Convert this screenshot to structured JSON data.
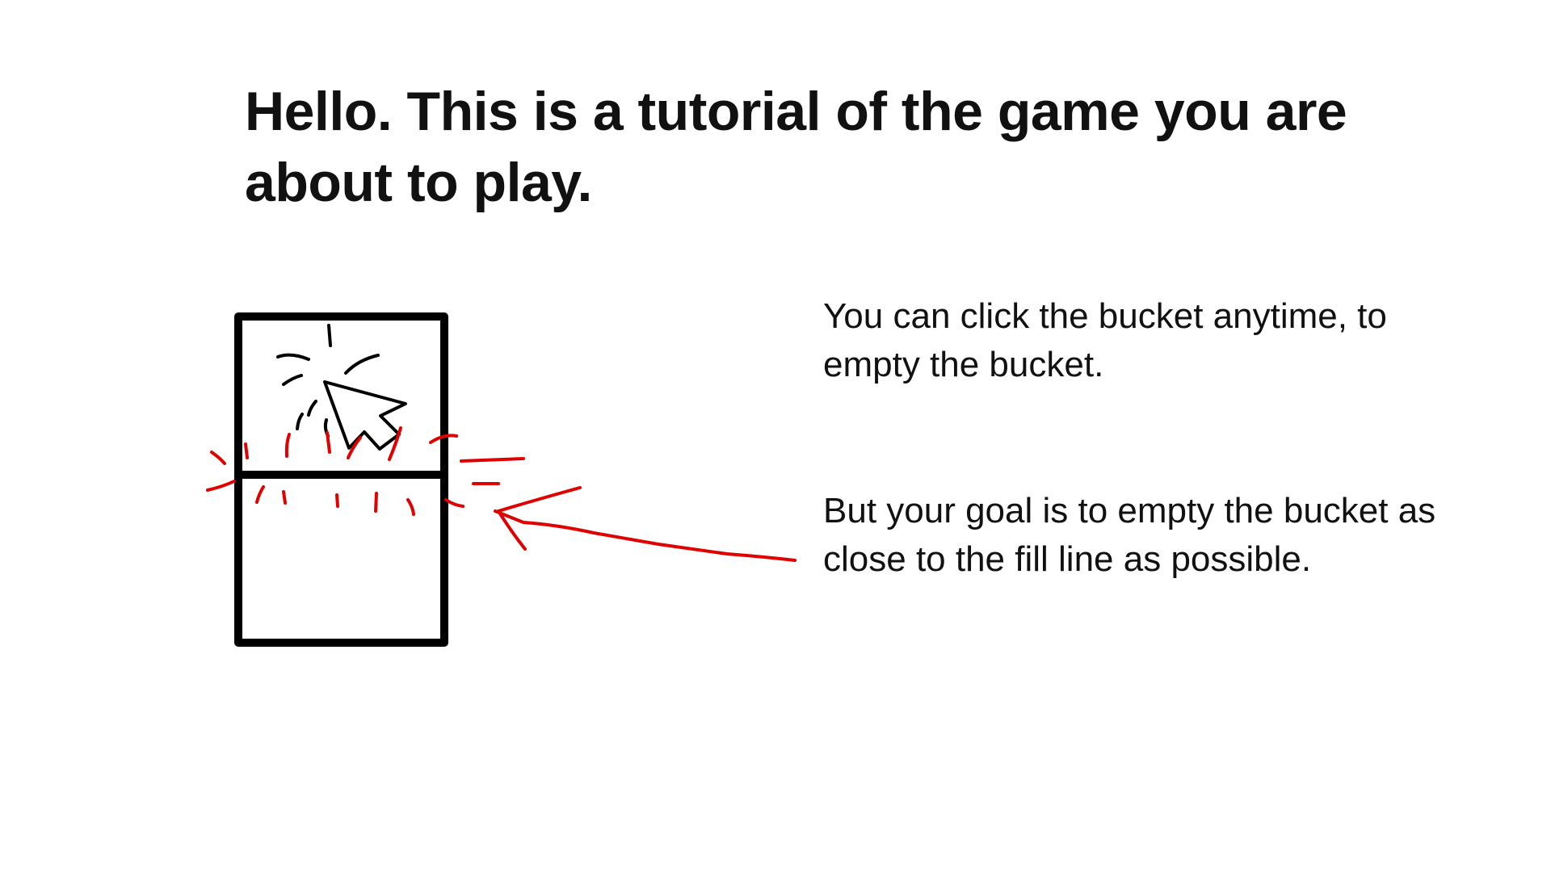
{
  "title": "Hello. This is a tutorial of the game you are about to play.",
  "instructions": {
    "click_hint": "You can click the bucket anytime, to empty the bucket.",
    "goal_hint": "But your goal is to empty the bucket as close to the fill line as possible."
  },
  "colors": {
    "ink": "#000000",
    "annotation": "#e00000"
  },
  "icons": {
    "cursor": "mouse-pointer-click-icon",
    "arrow": "hand-drawn-arrow-icon"
  }
}
